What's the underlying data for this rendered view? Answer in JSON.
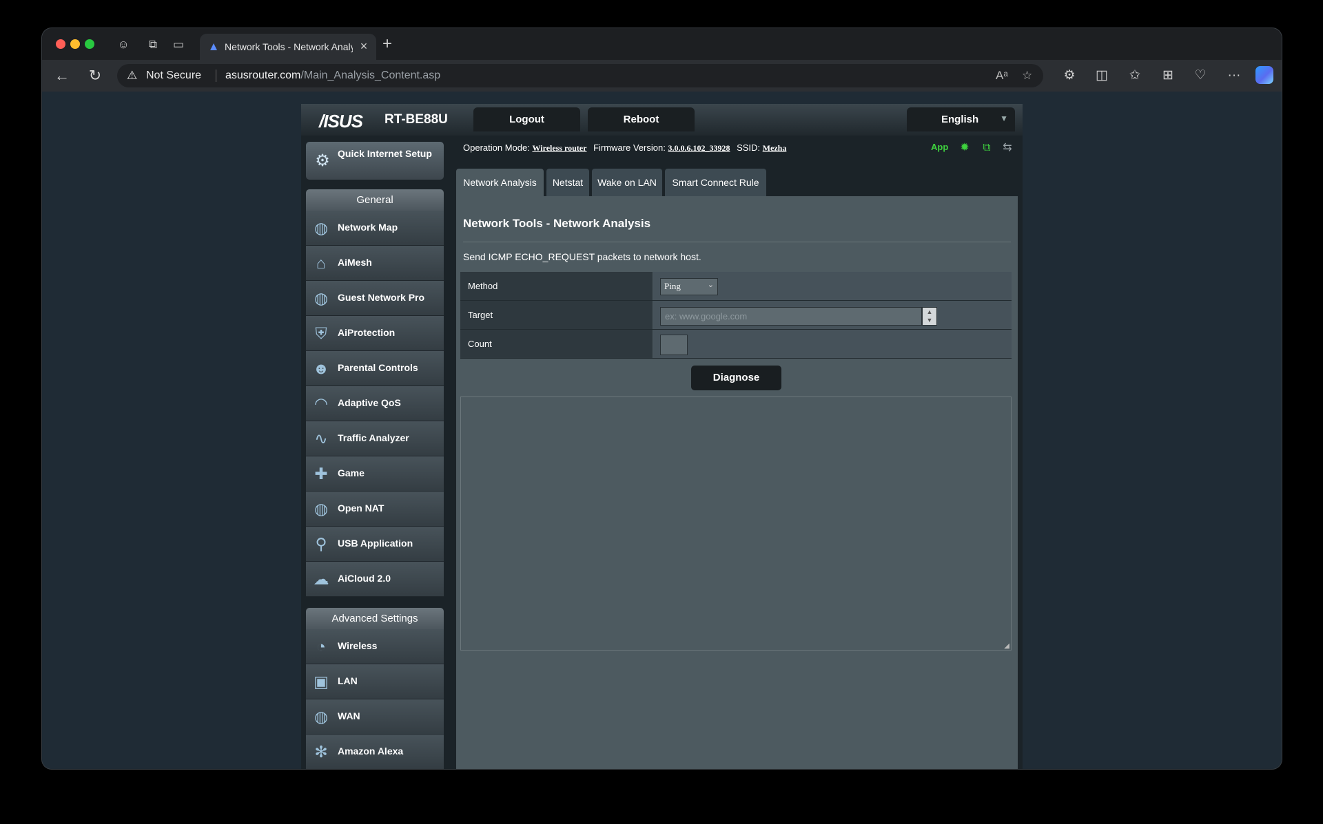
{
  "browser": {
    "tab_title": "Network Tools - Network Analy",
    "new_tab": "+",
    "close_tab": "×",
    "security_label": "Not Secure",
    "url_host": "asusrouter.com",
    "url_path": "/Main_Analysis_Content.asp",
    "more": "···"
  },
  "router": {
    "brand": "/ISUS",
    "model": "RT-BE88U",
    "logout": "Logout",
    "reboot": "Reboot",
    "language": "English"
  },
  "status": {
    "op_mode_label": "Operation Mode:",
    "op_mode_value": "Wireless router",
    "firmware_label": "Firmware Version:",
    "firmware_value": "3.0.0.6.102_33928",
    "ssid_label": "SSID:",
    "ssid_value": "Mezha",
    "app": "App"
  },
  "sidebar": {
    "qis": "Quick Internet Setup",
    "general_header": "General",
    "general_items": [
      "Network Map",
      "AiMesh",
      "Guest Network Pro",
      "AiProtection",
      "Parental Controls",
      "Adaptive QoS",
      "Traffic Analyzer",
      "Game",
      "Open NAT",
      "USB Application",
      "AiCloud 2.0"
    ],
    "advanced_header": "Advanced Settings",
    "advanced_items": [
      "Wireless",
      "LAN",
      "WAN",
      "Amazon Alexa"
    ]
  },
  "tabs": [
    "Network Analysis",
    "Netstat",
    "Wake on LAN",
    "Smart Connect Rule"
  ],
  "content": {
    "title": "Network Tools - Network Analysis",
    "description": "Send ICMP ECHO_REQUEST packets to network host.",
    "method_label": "Method",
    "method_value": "Ping",
    "target_label": "Target",
    "target_placeholder": "ex: www.google.com",
    "count_label": "Count",
    "count_value": "",
    "diagnose": "Diagnose"
  },
  "colors": {
    "accent_green": "#3ed13e",
    "tab_icon": "#5b8cff"
  }
}
